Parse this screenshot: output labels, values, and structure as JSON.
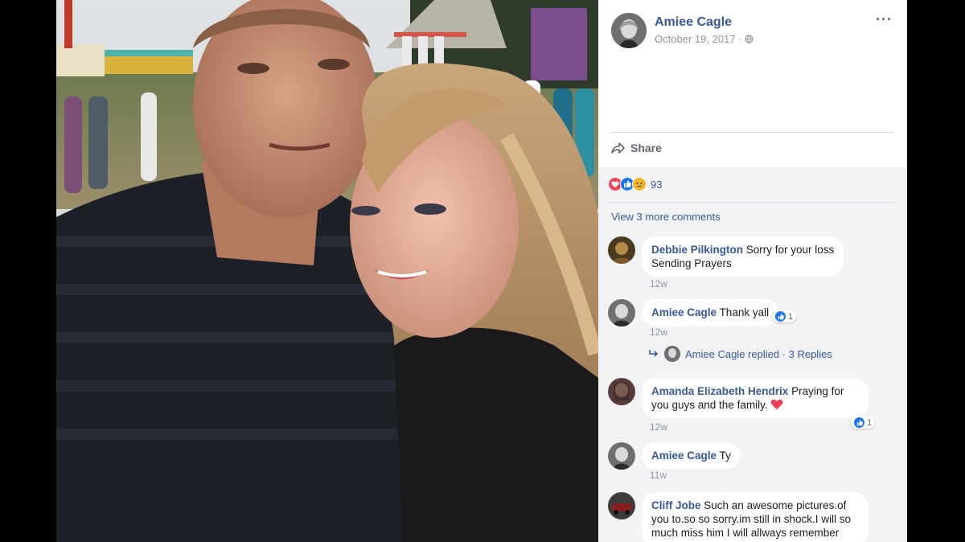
{
  "post": {
    "author": "Amiee Cagle",
    "date": "October 19, 2017 ·",
    "more_label": "···",
    "share_label": "Share",
    "reaction_count": "93",
    "view_more_comments": "View 3 more comments"
  },
  "comments": [
    {
      "name": "Debbie Pilkington",
      "text_line1": "Sorry for your loss",
      "text_line2": "Sending Prayers",
      "time": "12w"
    },
    {
      "name": "Amiee Cagle",
      "text": "Thank yall",
      "time": "12w",
      "likes": "1",
      "replies_label": "Amiee Cagle replied · 3 Replies"
    },
    {
      "name": "Amanda Elizabeth Hendrix",
      "text_line1": "Praying for",
      "text_line2": "you guys and the family.",
      "time": "12w",
      "likes": "1"
    },
    {
      "name": "Amiee Cagle",
      "text": "Ty",
      "time": "11w"
    },
    {
      "name": "Cliff Jobe",
      "text_line1": "Such an awesome pictures.of",
      "text_line2": "you to.so so sorry.im still in shock.I will so",
      "text_line3": "much miss him I will allways remember"
    }
  ],
  "colors": {
    "link_blue": "#385898",
    "comment_bg": "#f2f3f5",
    "like_blue": "#1877f2",
    "love_red": "#f33e58",
    "sad_yellow": "#f7b125"
  },
  "icons": {
    "share": "share-arrow-icon",
    "privacy": "globe-icon",
    "reply": "reply-arrow-icon"
  }
}
